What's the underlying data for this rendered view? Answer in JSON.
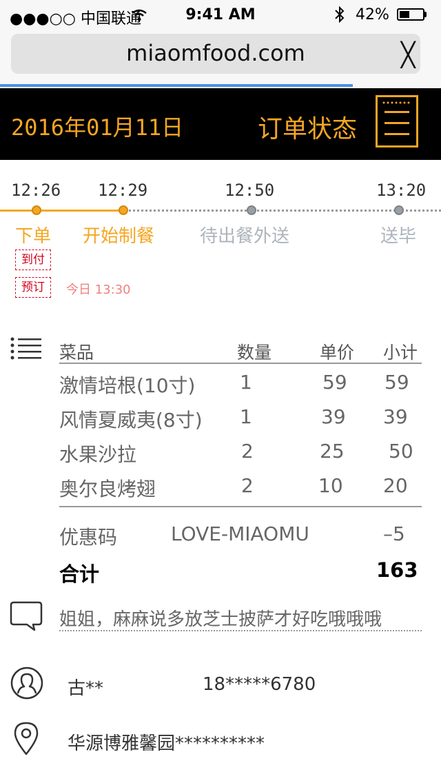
{
  "status_bar": {
    "carrier": "●●●○○ 中国联通",
    "time": "9:41 AM",
    "battery_pct": "42%"
  },
  "browser": {
    "url": "miaomfood.com",
    "close_label": "╳",
    "load_progress": 0.8
  },
  "header": {
    "date": "2016年01月11日",
    "title": "订单状态",
    "accent_color": "#f5a623"
  },
  "timeline": {
    "steps": [
      {
        "time": "12:26",
        "label": "下单",
        "state": "done"
      },
      {
        "time": "12:29",
        "label": "开始制餐",
        "state": "done"
      },
      {
        "time": "12:50",
        "label": "待出餐外送",
        "state": "pending"
      },
      {
        "time": "13:20",
        "label": "送毕",
        "state": "pending"
      }
    ]
  },
  "tags": {
    "cod": "到付",
    "reserve": "预订",
    "reserve_time": "今日 13:30"
  },
  "table": {
    "headers": {
      "dish": "菜品",
      "qty": "数量",
      "price": "单价",
      "subtotal": "小计"
    },
    "rows": [
      {
        "dish": "激情培根(10寸)",
        "qty": "1",
        "price": "59",
        "subtotal": "59"
      },
      {
        "dish": "风情夏威夷(8寸)",
        "qty": "1",
        "price": "39",
        "subtotal": "39"
      },
      {
        "dish": "水果沙拉",
        "qty": "2",
        "price": "25",
        "subtotal": "50"
      },
      {
        "dish": "奥尔良烤翅",
        "qty": "2",
        "price": "10",
        "subtotal": "20"
      }
    ],
    "promo_label": "优惠码",
    "promo_code": "LOVE-MIAOMU",
    "promo_value": "–5",
    "total_label": "合计",
    "total_value": "163"
  },
  "note": "姐姐，麻麻说多放芝士披萨才好吃哦哦哦",
  "contact": {
    "name": "古**",
    "phone": "18*****6780",
    "address": "华源博雅馨园**********"
  }
}
